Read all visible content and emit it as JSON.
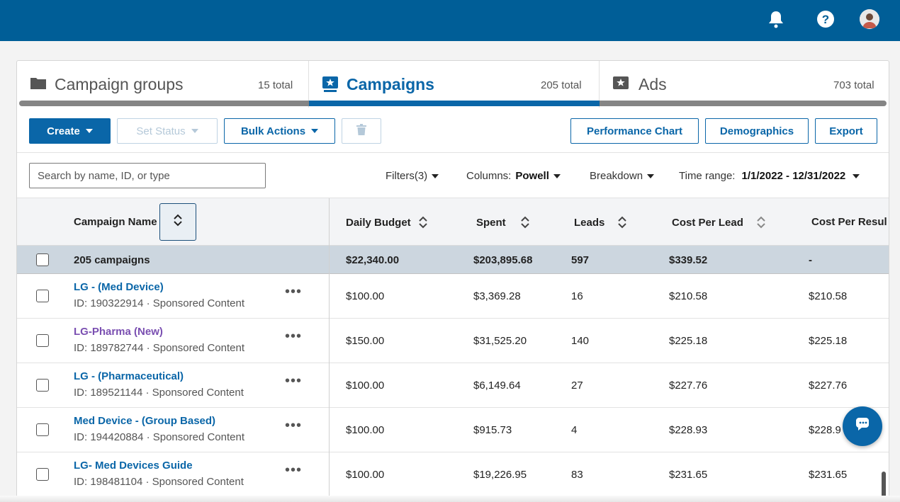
{
  "tabs": [
    {
      "label": "Campaign groups",
      "count": "15 total"
    },
    {
      "label": "Campaigns",
      "count": "205 total"
    },
    {
      "label": "Ads",
      "count": "703 total"
    }
  ],
  "toolbar": {
    "create": "Create",
    "set_status": "Set Status",
    "bulk_actions": "Bulk Actions",
    "performance_chart": "Performance Chart",
    "demographics": "Demographics",
    "export": "Export"
  },
  "filters": {
    "search_placeholder": "Search by name, ID, or type",
    "filters_label": "Filters(3)",
    "columns_label": "Columns:",
    "columns_value": "Powell",
    "breakdown": "Breakdown",
    "time_range_label": "Time range:",
    "time_range_value": "1/1/2022 - 12/31/2022"
  },
  "table": {
    "headers": [
      "Campaign Name",
      "Daily Budget",
      "Spent",
      "Leads",
      "Cost Per Lead",
      "Cost Per Resul"
    ],
    "summary": {
      "name": "205 campaigns",
      "budget": "$22,340.00",
      "spent": "$203,895.68",
      "leads": "597",
      "cpl": "$339.52",
      "cpr": "-"
    },
    "rows": [
      {
        "name": "LG - (Med Device)",
        "sub": "ID: 190322914 · Sponsored Content",
        "budget": "$100.00",
        "spent": "$3,369.28",
        "leads": "16",
        "cpl": "$210.58",
        "cpr": "$210.58"
      },
      {
        "name": "LG-Pharma (New)",
        "sub": "ID: 189782744 · Sponsored Content",
        "budget": "$150.00",
        "spent": "$31,525.20",
        "leads": "140",
        "cpl": "$225.18",
        "cpr": "$225.18"
      },
      {
        "name": "LG - (Pharmaceutical)",
        "sub": "ID: 189521144 · Sponsored Content",
        "budget": "$100.00",
        "spent": "$6,149.64",
        "leads": "27",
        "cpl": "$227.76",
        "cpr": "$227.76"
      },
      {
        "name": "Med Device - (Group Based)",
        "sub": "ID: 194420884 · Sponsored Content",
        "budget": "$100.00",
        "spent": "$915.73",
        "leads": "4",
        "cpl": "$228.93",
        "cpr": "$228.9"
      },
      {
        "name": "LG- Med Devices Guide",
        "sub": "ID: 198481104 · Sponsored Content",
        "budget": "$100.00",
        "spent": "$19,226.95",
        "leads": "83",
        "cpl": "$231.65",
        "cpr": "$231.65"
      }
    ],
    "more_glyph": "•••"
  },
  "icons": [
    "bell-icon",
    "help-icon",
    "avatar",
    "folder-icon",
    "campaign-icon",
    "ad-icon",
    "trash-icon",
    "sort-icon",
    "chat-icon"
  ],
  "colors": {
    "brand": "#005e97",
    "accent": "#0a66a8",
    "visited": "#7a4fb1"
  }
}
